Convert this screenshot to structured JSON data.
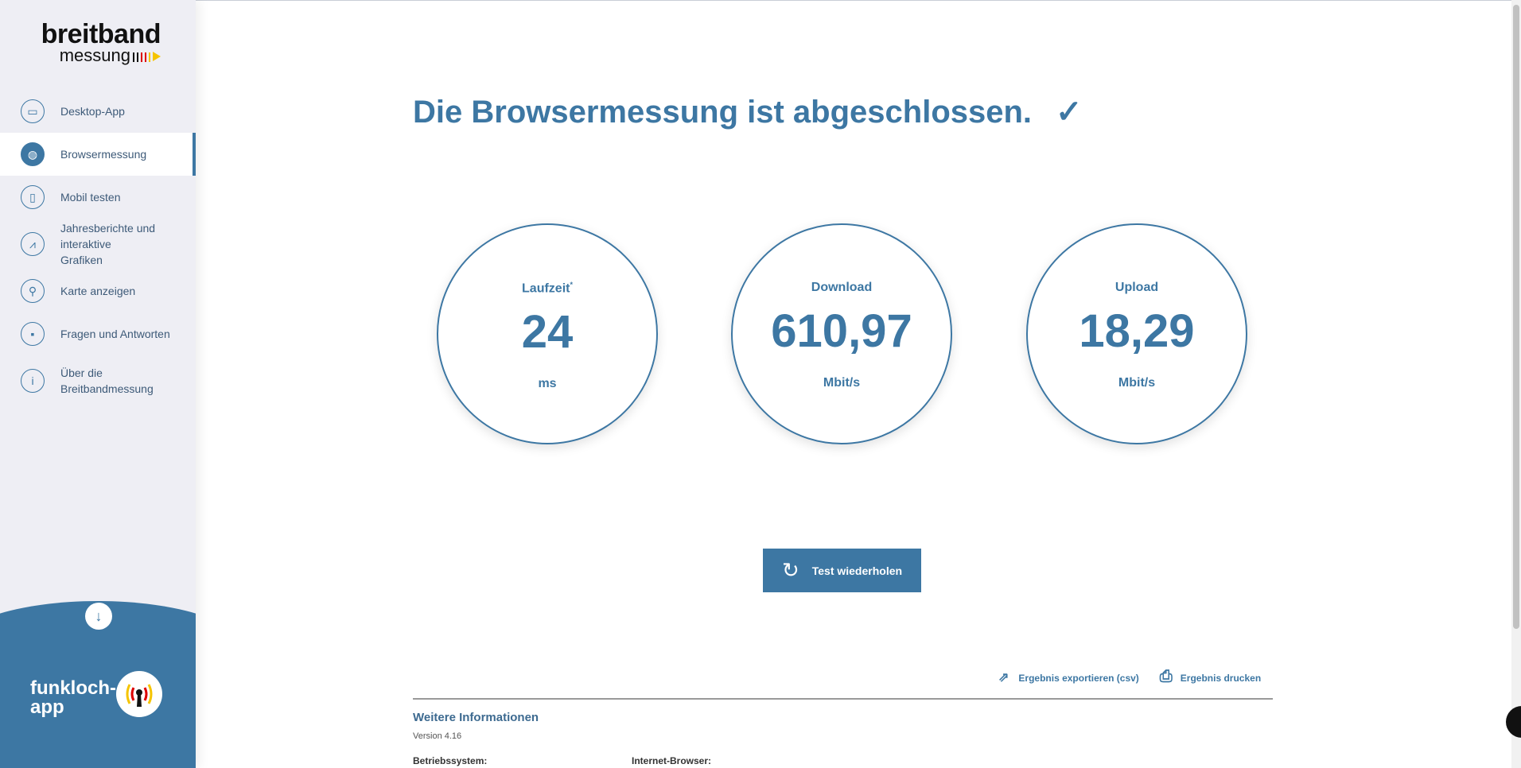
{
  "logo": {
    "line1": "breitband",
    "line2": "messung"
  },
  "sidebar": {
    "items": [
      {
        "label": "Desktop-App",
        "icon": "monitor-icon"
      },
      {
        "label": "Browsermessung",
        "icon": "globe-icon"
      },
      {
        "label": "Mobil testen",
        "icon": "phone-icon"
      },
      {
        "label": "Jahresberichte und interaktive Grafiken",
        "icon": "chart-icon"
      },
      {
        "label": "Karte anzeigen",
        "icon": "map-pin-icon"
      },
      {
        "label": "Fragen und Antworten",
        "icon": "chat-icon"
      },
      {
        "label": "Über die Breitbandmessung",
        "icon": "info-icon"
      }
    ],
    "funkloch": "funkloch-\napp"
  },
  "main": {
    "title": "Die Browsermessung ist abgeschlossen.",
    "results": [
      {
        "label": "Laufzeit",
        "sup": "*",
        "value": "24",
        "unit": "ms"
      },
      {
        "label": "Download",
        "value": "610,97",
        "unit": "Mbit/s"
      },
      {
        "label": "Upload",
        "value": "18,29",
        "unit": "Mbit/s"
      }
    ],
    "repeat_button": "Test wiederholen",
    "export": "Ergebnis exportieren (csv)",
    "print": "Ergebnis drucken",
    "more_info": "Weitere Informationen",
    "version": "Version 4.16",
    "os_label": "Betriebssystem:",
    "browser_label": "Internet-Browser:"
  },
  "colors": {
    "accent": "#3d77a3",
    "sidebar": "#eeeef4"
  }
}
